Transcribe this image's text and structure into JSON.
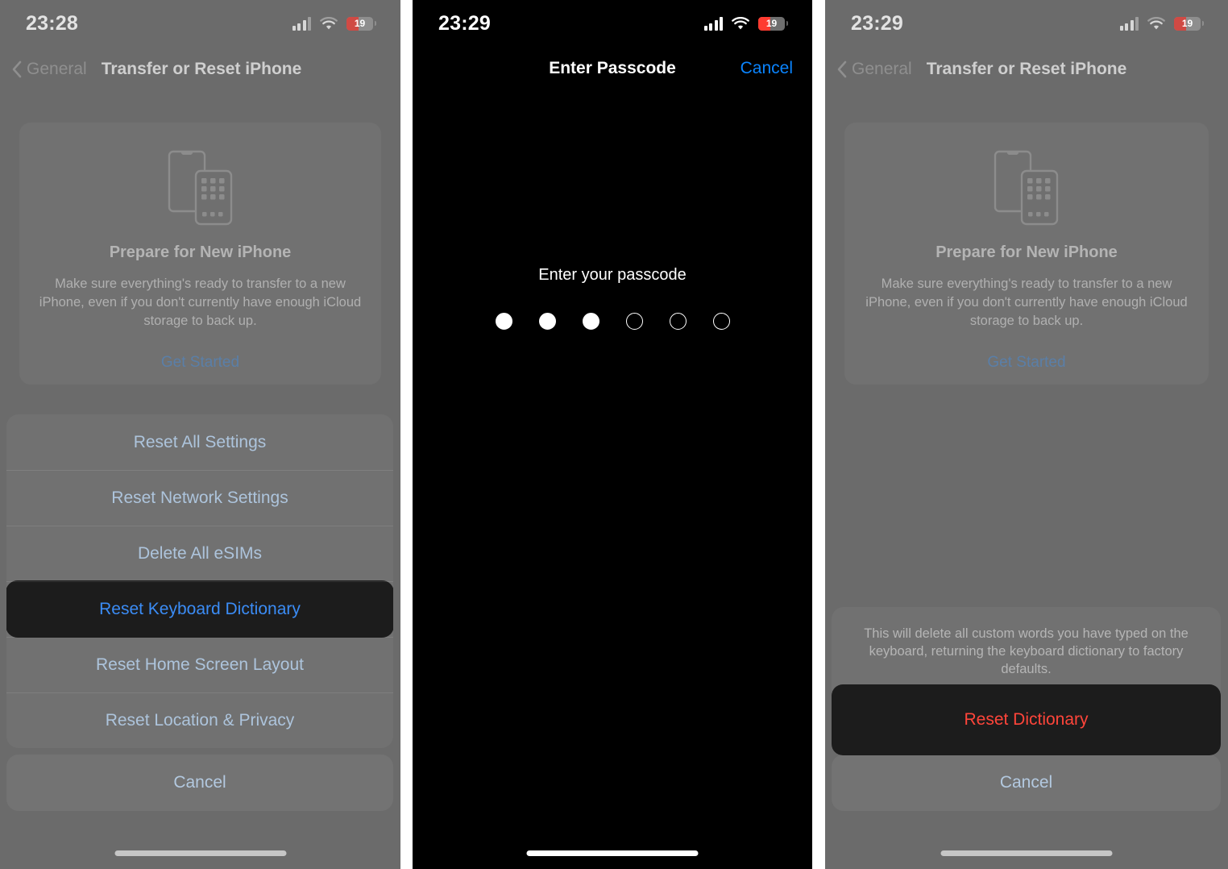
{
  "panels": {
    "left": {
      "status": {
        "time": "23:28",
        "battery_percent": "19"
      },
      "nav": {
        "back_label": "General",
        "title": "Transfer or Reset iPhone"
      },
      "card": {
        "title": "Prepare for New iPhone",
        "body": "Make sure everything's ready to transfer to a new iPhone, even if you don't currently have enough iCloud storage to back up.",
        "link": "Get Started"
      },
      "action_sheet": {
        "options": [
          "Reset All Settings",
          "Reset Network Settings",
          "Delete All eSIMs",
          "Reset Keyboard Dictionary",
          "Reset Home Screen Layout",
          "Reset Location & Privacy"
        ],
        "selected_option": "Reset Keyboard Dictionary",
        "cancel_label": "Cancel"
      }
    },
    "middle": {
      "status": {
        "time": "23:29",
        "battery_percent": "19"
      },
      "nav": {
        "title": "Enter Passcode",
        "cancel_label": "Cancel"
      },
      "passcode": {
        "prompt": "Enter your passcode",
        "total_dots": 6,
        "filled_dots": 3
      }
    },
    "right": {
      "status": {
        "time": "23:29",
        "battery_percent": "19"
      },
      "nav": {
        "back_label": "General",
        "title": "Transfer or Reset iPhone"
      },
      "card": {
        "title": "Prepare for New iPhone",
        "body": "Make sure everything's ready to transfer to a new iPhone, even if you don't currently have enough iCloud storage to back up.",
        "link": "Get Started"
      },
      "confirm_sheet": {
        "message": "This will delete all custom words you have typed on the keyboard, returning the keyboard dictionary to factory defaults.",
        "destructive_label": "Reset Dictionary",
        "cancel_label": "Cancel"
      }
    }
  },
  "colors": {
    "ios_blue": "#0a84ff",
    "ios_red": "#ff453a",
    "battery_red": "#ff3b30",
    "dimmed_bg": "#6b6b6b",
    "sheet_bg": "#717171",
    "highlight_bg": "#1c1c1c"
  },
  "icons": {
    "back_chevron": "chevron-left-icon",
    "signal": "cellular-signal-icon",
    "wifi": "wifi-icon",
    "battery": "battery-icon",
    "illustration": "two-iphones-icon"
  }
}
